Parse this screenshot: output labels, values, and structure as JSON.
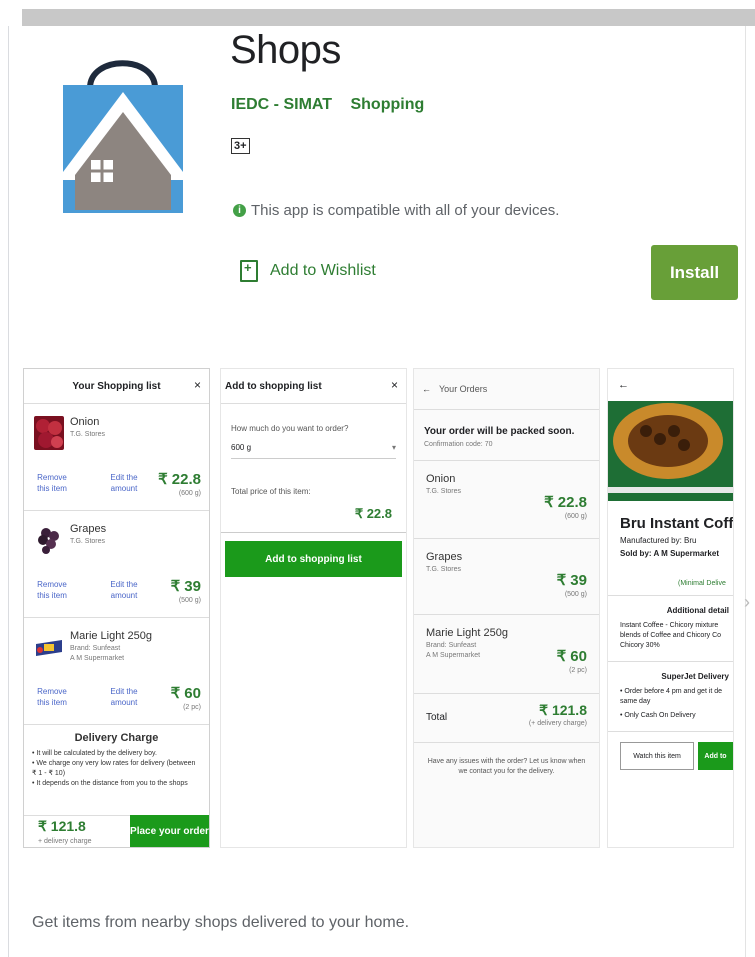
{
  "app": {
    "title": "Shops",
    "developer": "IEDC - SIMAT",
    "category": "Shopping",
    "content_rating": "3+",
    "compat_icon": "i",
    "compatibility": "This app is compatible with all of your devices.",
    "wishlist_label": "Add to Wishlist",
    "install_label": "Install",
    "description": "Get items from nearby shops delivered to your home."
  },
  "shot1": {
    "title": "Your Shopping list",
    "close": "×",
    "items": [
      {
        "name": "Onion",
        "sub1": "T.G. Stores",
        "sub2": "",
        "remove": "Remove this item",
        "edit": "Edit the amount",
        "price": "₹ 22.8",
        "qty": "(600 g)"
      },
      {
        "name": "Grapes",
        "sub1": "T.G. Stores",
        "sub2": "",
        "remove": "Remove this item",
        "edit": "Edit the amount",
        "price": "₹ 39",
        "qty": "(500 g)"
      },
      {
        "name": "Marie Light 250g",
        "sub1": "Brand: Sunfeast",
        "sub2": "A M Supermarket",
        "remove": "Remove this item",
        "edit": "Edit the amount",
        "price": "₹ 60",
        "qty": "(2 pc)"
      }
    ],
    "delivery_title": "Delivery Charge",
    "delivery_lines": [
      "• It will be calculated by the delivery boy.",
      "• We charge ony very low rates for delivery (between ₹ 1 - ₹ 10)",
      "• It depends on the distance from you to the shops"
    ],
    "total": "₹ 121.8",
    "total_note": "+ delivery charge",
    "order_button": "Place your order"
  },
  "shot2": {
    "title": "Add to shopping list",
    "close": "×",
    "question": "How much do you want to order?",
    "amount": "600 g",
    "total_label": "Total price of this item:",
    "total_value": "₹ 22.8",
    "button": "Add to shopping list"
  },
  "shot3": {
    "title": "Your Orders",
    "packed": "Your order will be packed soon.",
    "code": "Confirmation code: 70",
    "items": [
      {
        "name": "Onion",
        "sub1": "T.G. Stores",
        "sub2": "",
        "price": "₹ 22.8",
        "qty": "(600 g)"
      },
      {
        "name": "Grapes",
        "sub1": "T.G. Stores",
        "sub2": "",
        "price": "₹ 39",
        "qty": "(500 g)"
      },
      {
        "name": "Marie Light 250g",
        "sub1": "Brand: Sunfeast",
        "sub2": "A M Supermarket",
        "price": "₹ 60",
        "qty": "(2 pc)"
      }
    ],
    "total_label": "Total",
    "total_value": "₹ 121.8",
    "total_note": "(+ delivery charge)",
    "help": "Have any issues with the order? Let us know when we contact you for the delivery."
  },
  "shot4": {
    "product": "Bru Instant Coffe",
    "manufactured": "Manufactured by:  Bru",
    "sold": "Sold by:  A M Supermarket",
    "minimal": "(Minimal Delive",
    "details_title": "Additional detail",
    "details": "Instant Coffee - Chicory mixture blends of Coffee and Chicory Co Chicory 30%",
    "superjet": "SuperJet Delivery",
    "bullets": [
      "• Order before 4 pm and get it de same day",
      "• Only Cash On Delivery"
    ],
    "watch": "Watch this item",
    "add": "Add to"
  }
}
